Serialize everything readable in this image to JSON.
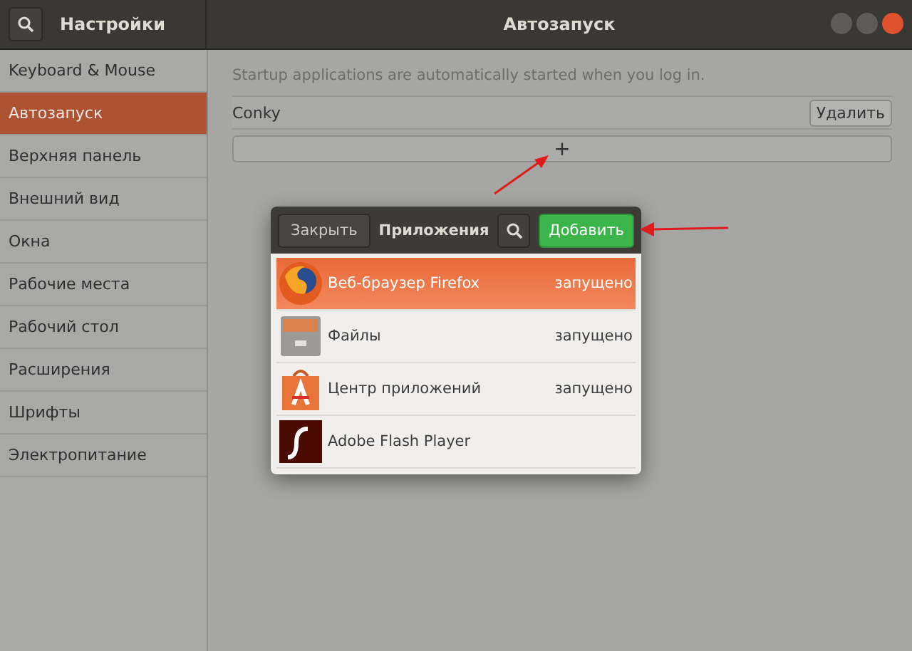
{
  "window": {
    "sidebar_title": "Настройки",
    "title": "Автозапуск"
  },
  "sidebar": {
    "items": [
      {
        "label": "Keyboard & Mouse",
        "selected": false
      },
      {
        "label": "Автозапуск",
        "selected": true
      },
      {
        "label": "Верхняя панель",
        "selected": false
      },
      {
        "label": "Внешний вид",
        "selected": false
      },
      {
        "label": "Окна",
        "selected": false
      },
      {
        "label": "Рабочие места",
        "selected": false
      },
      {
        "label": "Рабочий стол",
        "selected": false
      },
      {
        "label": "Расширения",
        "selected": false
      },
      {
        "label": "Шрифты",
        "selected": false
      },
      {
        "label": "Электропитание",
        "selected": false
      }
    ]
  },
  "content": {
    "description": "Startup applications are automatically started when you log in.",
    "entries": [
      {
        "name": "Conky",
        "remove_label": "Удалить"
      }
    ],
    "add_label": "+"
  },
  "dialog": {
    "close_label": "Закрыть",
    "title": "Приложения",
    "add_label": "Добавить",
    "apps": [
      {
        "name": "Веб-браузер Firefox",
        "status": "запущено",
        "selected": true,
        "kind": "browser"
      },
      {
        "name": "Файлы",
        "status": "запущено",
        "selected": false,
        "kind": "files"
      },
      {
        "name": "Центр приложений",
        "status": "запущено",
        "selected": false,
        "kind": "store"
      },
      {
        "name": "Adobe Flash Player",
        "selected": false,
        "kind": "flash"
      }
    ]
  }
}
